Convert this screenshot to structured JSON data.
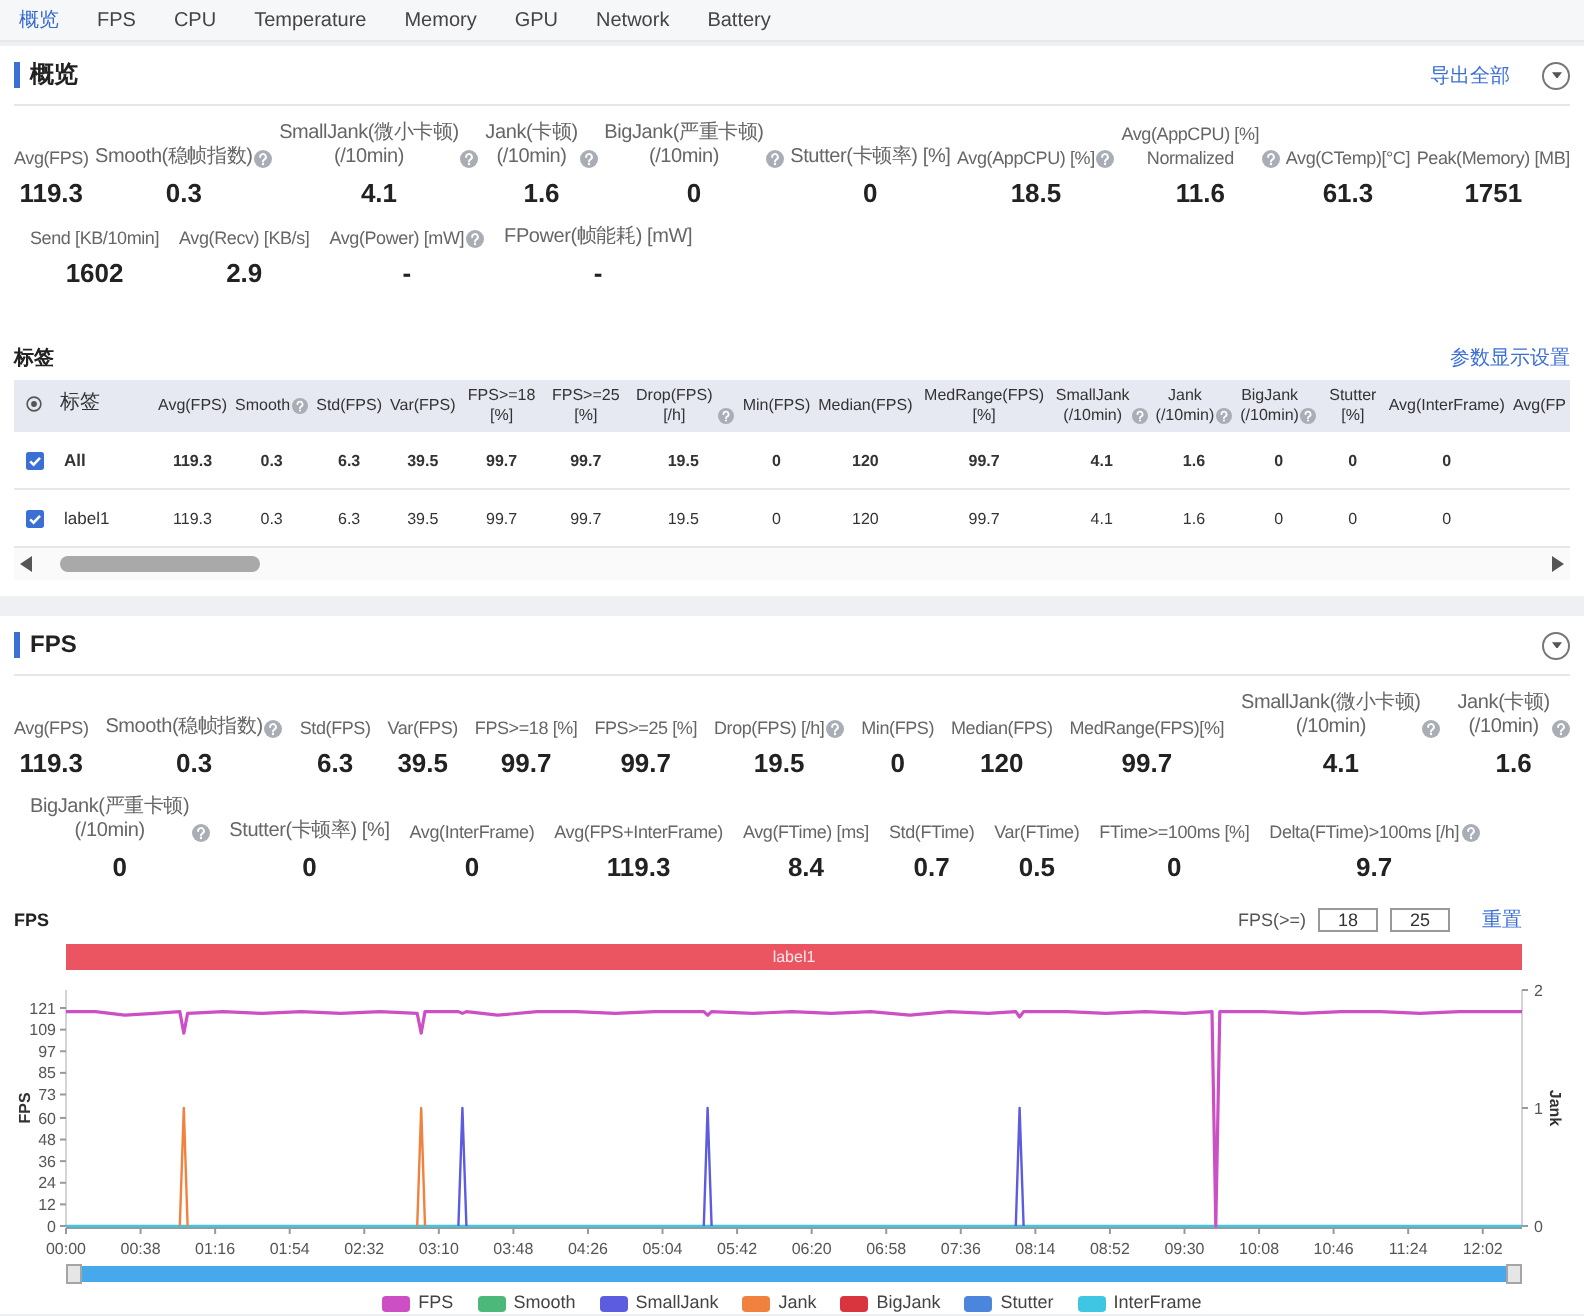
{
  "tabs": [
    {
      "label": "概览",
      "selected": true
    },
    {
      "label": "FPS",
      "selected": false
    },
    {
      "label": "CPU",
      "selected": false
    },
    {
      "label": "Temperature",
      "selected": false
    },
    {
      "label": "Memory",
      "selected": false
    },
    {
      "label": "GPU",
      "selected": false
    },
    {
      "label": "Network",
      "selected": false
    },
    {
      "label": "Battery",
      "selected": false
    }
  ],
  "overview": {
    "title": "概览",
    "export_link": "导出全部",
    "stat_rows": [
      [
        {
          "label": "Avg(FPS)",
          "value": "119.3",
          "help": false
        },
        {
          "label": "Smooth(稳帧指数)",
          "value": "0.3",
          "help": true
        },
        {
          "label": "SmallJank(微小卡顿)\n(/10min)",
          "value": "4.1",
          "help": true
        },
        {
          "label": "Jank(卡顿)\n(/10min)",
          "value": "1.6",
          "help": true
        },
        {
          "label": "BigJank(严重卡顿)\n(/10min)",
          "value": "0",
          "help": true
        },
        {
          "label": "Stutter(卡顿率) [%]",
          "value": "0",
          "help": false
        },
        {
          "label": "Avg(AppCPU) [%]",
          "value": "18.5",
          "help": true
        },
        {
          "label": "Avg(AppCPU) [%]\nNormalized",
          "value": "11.6",
          "help": true
        },
        {
          "label": "Avg(CTemp)[°C]",
          "value": "61.3",
          "help": false
        },
        {
          "label": "Peak(Memory) [MB]",
          "value": "1751",
          "help": false
        }
      ],
      [
        {
          "label": "Send [KB/10min]",
          "value": "1602",
          "help": false
        },
        {
          "label": "Avg(Recv) [KB/s]",
          "value": "2.9",
          "help": false
        },
        {
          "label": "Avg(Power) [mW]",
          "value": "-",
          "help": true
        },
        {
          "label": "FPower(帧能耗) [mW]",
          "value": "-",
          "help": false
        }
      ]
    ],
    "tags": {
      "title": "标签",
      "settings_link": "参数显示设置",
      "columns": [
        {
          "label": "标签",
          "help": false
        },
        {
          "label": "Avg(FPS)",
          "help": false
        },
        {
          "label": "Smooth",
          "help": true
        },
        {
          "label": "Std(FPS)",
          "help": false
        },
        {
          "label": "Var(FPS)",
          "help": false
        },
        {
          "label": "FPS>=18 [%]",
          "help": false
        },
        {
          "label": "FPS>=25 [%]",
          "help": false
        },
        {
          "label": "Drop(FPS) [/h]",
          "help": true
        },
        {
          "label": "Min(FPS)",
          "help": false
        },
        {
          "label": "Median(FPS)",
          "help": false
        },
        {
          "label": "MedRange(FPS)[%]",
          "help": false
        },
        {
          "label": "SmallJank\n(/10min)",
          "help": true
        },
        {
          "label": "Jank\n(/10min)",
          "help": true
        },
        {
          "label": "BigJank\n(/10min)",
          "help": true
        },
        {
          "label": "Stutter [%]",
          "help": false
        },
        {
          "label": "Avg(InterFrame)",
          "help": false
        },
        {
          "label": "Avg(FP",
          "help": false
        }
      ],
      "rows": [
        {
          "kind": "total",
          "checked": true,
          "cells": [
            "All",
            "119.3",
            "0.3",
            "6.3",
            "39.5",
            "99.7",
            "99.7",
            "19.5",
            "0",
            "120",
            "99.7",
            "4.1",
            "1.6",
            "0",
            "0",
            "0"
          ]
        },
        {
          "kind": "label",
          "checked": true,
          "cells": [
            "label1",
            "119.3",
            "0.3",
            "6.3",
            "39.5",
            "99.7",
            "99.7",
            "19.5",
            "0",
            "120",
            "99.7",
            "4.1",
            "1.6",
            "0",
            "0",
            "0"
          ]
        }
      ]
    }
  },
  "fps": {
    "title": "FPS",
    "stat_rows": [
      [
        {
          "label": "Avg(FPS)",
          "value": "119.3",
          "help": false
        },
        {
          "label": "Smooth(稳帧指数)",
          "value": "0.3",
          "help": true
        },
        {
          "label": "Std(FPS)",
          "value": "6.3",
          "help": false
        },
        {
          "label": "Var(FPS)",
          "value": "39.5",
          "help": false
        },
        {
          "label": "FPS>=18 [%]",
          "value": "99.7",
          "help": false
        },
        {
          "label": "FPS>=25 [%]",
          "value": "99.7",
          "help": false
        },
        {
          "label": "Drop(FPS) [/h]",
          "value": "19.5",
          "help": true
        },
        {
          "label": "Min(FPS)",
          "value": "0",
          "help": false
        },
        {
          "label": "Median(FPS)",
          "value": "120",
          "help": false
        },
        {
          "label": "MedRange(FPS)[%]",
          "value": "99.7",
          "help": false
        },
        {
          "label": "SmallJank(微小卡顿)\n(/10min)",
          "value": "4.1",
          "help": true
        },
        {
          "label": "Jank(卡顿)\n(/10min)",
          "value": "1.6",
          "help": true
        }
      ],
      [
        {
          "label": "BigJank(严重卡顿)\n(/10min)",
          "value": "0",
          "help": true
        },
        {
          "label": "Stutter(卡顿率) [%]",
          "value": "0",
          "help": false
        },
        {
          "label": "Avg(InterFrame)",
          "value": "0",
          "help": false
        },
        {
          "label": "Avg(FPS+InterFrame)",
          "value": "119.3",
          "help": false
        },
        {
          "label": "Avg(FTime) [ms]",
          "value": "8.4",
          "help": false
        },
        {
          "label": "Std(FTime)",
          "value": "0.7",
          "help": false
        },
        {
          "label": "Var(FTime)",
          "value": "0.5",
          "help": false
        },
        {
          "label": "FTime>=100ms [%]",
          "value": "0",
          "help": false
        },
        {
          "label": "Delta(FTime)>100ms [/h]",
          "value": "9.7",
          "help": true
        }
      ]
    ],
    "chart": {
      "threshold_label": "FPS(>=)",
      "thresholds": [
        "18",
        "25"
      ],
      "reset_link": "重置",
      "label_band": "label1",
      "chart_data": {
        "type": "line",
        "title": "FPS",
        "ylabel": "FPS",
        "y2label": "Jank",
        "legend": "bottom",
        "x": [
          0,
          15,
          30,
          45,
          58,
          60,
          62,
          80,
          100,
          120,
          140,
          160,
          179,
          181,
          183,
          200,
          202,
          204,
          220,
          240,
          260,
          280,
          300,
          325,
          327,
          329,
          350,
          370,
          390,
          410,
          430,
          450,
          470,
          484,
          486,
          488,
          510,
          530,
          550,
          570,
          584,
          586,
          588,
          610,
          630,
          650,
          670,
          690,
          710,
          730,
          742
        ],
        "xlim": [
          0,
          742
        ],
        "xticks": [
          {
            "value": 0,
            "label": "00:00"
          },
          {
            "value": 38,
            "label": "00:38"
          },
          {
            "value": 76,
            "label": "01:16"
          },
          {
            "value": 114,
            "label": "01:54"
          },
          {
            "value": 152,
            "label": "02:32"
          },
          {
            "value": 190,
            "label": "03:10"
          },
          {
            "value": 228,
            "label": "03:48"
          },
          {
            "value": 266,
            "label": "04:26"
          },
          {
            "value": 304,
            "label": "05:04"
          },
          {
            "value": 342,
            "label": "05:42"
          },
          {
            "value": 380,
            "label": "06:20"
          },
          {
            "value": 418,
            "label": "06:58"
          },
          {
            "value": 456,
            "label": "07:36"
          },
          {
            "value": 494,
            "label": "08:14"
          },
          {
            "value": 532,
            "label": "08:52"
          },
          {
            "value": 570,
            "label": "09:30"
          },
          {
            "value": 608,
            "label": "10:08"
          },
          {
            "value": 646,
            "label": "10:46"
          },
          {
            "value": 684,
            "label": "11:24"
          },
          {
            "value": 722,
            "label": "12:02"
          }
        ],
        "ylim": [
          0,
          131
        ],
        "yticks": [
          0,
          12,
          24,
          36,
          48,
          60,
          73,
          85,
          97,
          109,
          121
        ],
        "y2lim": [
          0,
          2
        ],
        "y2ticks": [
          0,
          1,
          2
        ],
        "series": [
          {
            "name": "FPS",
            "color": "#cc4fc4",
            "values": [
              119,
              119,
              117,
              118,
              119,
              107,
              118,
              119,
              118,
              119,
              118,
              119,
              118,
              107,
              119,
              119,
              118,
              119,
              117,
              119,
              119,
              118,
              119,
              119,
              117,
              119,
              118,
              119,
              118,
              119,
              117,
              119,
              118,
              119,
              116,
              119,
              119,
              118,
              119,
              118,
              119,
              0,
              119,
              119,
              118,
              119,
              119,
              118,
              119,
              119,
              119
            ]
          },
          {
            "name": "Smooth",
            "color": "#4cb87a",
            "axis": "y2",
            "values": [
              null,
              null,
              null,
              null,
              null,
              null,
              null,
              null,
              null,
              null,
              null,
              null,
              null,
              null,
              null,
              null,
              null,
              null,
              null,
              null,
              null,
              null,
              null,
              null,
              null,
              null,
              null,
              null,
              null,
              null,
              null,
              null,
              null,
              null,
              null,
              null,
              null,
              null,
              null,
              null,
              null,
              null,
              null,
              null,
              null,
              null,
              null,
              null,
              null,
              null,
              null
            ]
          },
          {
            "name": "SmallJank",
            "color": "#5c5ce0",
            "axis": "y2",
            "values": [
              null,
              null,
              null,
              null,
              null,
              null,
              null,
              null,
              null,
              null,
              null,
              null,
              null,
              null,
              null,
              0,
              1,
              0,
              null,
              null,
              null,
              null,
              null,
              0,
              1,
              0,
              null,
              null,
              null,
              null,
              null,
              null,
              null,
              0,
              1,
              0,
              null,
              null,
              null,
              null,
              null,
              null,
              null,
              null,
              null,
              null,
              null,
              null,
              null,
              null,
              null
            ]
          },
          {
            "name": "Jank",
            "color": "#f0813f",
            "axis": "y2",
            "values": [
              null,
              null,
              null,
              null,
              0,
              1,
              0,
              null,
              null,
              null,
              null,
              null,
              0,
              1,
              0,
              null,
              null,
              null,
              null,
              null,
              null,
              null,
              null,
              null,
              null,
              null,
              null,
              null,
              null,
              null,
              null,
              null,
              null,
              null,
              null,
              null,
              null,
              null,
              null,
              null,
              null,
              null,
              null,
              null,
              null,
              null,
              null,
              null,
              null,
              null,
              null
            ]
          },
          {
            "name": "BigJank",
            "color": "#d8353f",
            "axis": "y2",
            "values": [
              null,
              null,
              null,
              null,
              null,
              null,
              null,
              null,
              null,
              null,
              null,
              null,
              null,
              null,
              null,
              null,
              null,
              null,
              null,
              null,
              null,
              null,
              null,
              null,
              null,
              null,
              null,
              null,
              null,
              null,
              null,
              null,
              null,
              null,
              null,
              null,
              null,
              null,
              null,
              null,
              null,
              null,
              null,
              null,
              null,
              null,
              null,
              null,
              null,
              null,
              null
            ]
          },
          {
            "name": "Stutter",
            "color": "#4b86dc",
            "axis": "y2",
            "values": [
              null,
              null,
              null,
              null,
              null,
              null,
              null,
              null,
              null,
              null,
              null,
              null,
              null,
              null,
              null,
              null,
              null,
              null,
              null,
              null,
              null,
              null,
              null,
              null,
              null,
              null,
              null,
              null,
              null,
              null,
              null,
              null,
              null,
              null,
              null,
              null,
              null,
              null,
              null,
              null,
              null,
              null,
              null,
              null,
              null,
              null,
              null,
              null,
              null,
              null,
              null
            ]
          },
          {
            "name": "InterFrame",
            "color": "#3fc6e2",
            "axis": "y2",
            "values": [
              0,
              0,
              0,
              0,
              0,
              0,
              0,
              0,
              0,
              0,
              0,
              0,
              0,
              0,
              0,
              0,
              0,
              0,
              0,
              0,
              0,
              0,
              0,
              0,
              0,
              0,
              0,
              0,
              0,
              0,
              0,
              0,
              0,
              0,
              0,
              0,
              0,
              0,
              0,
              0,
              0,
              0,
              0,
              0,
              0,
              0,
              0,
              0,
              0,
              0,
              0
            ]
          }
        ]
      }
    }
  }
}
